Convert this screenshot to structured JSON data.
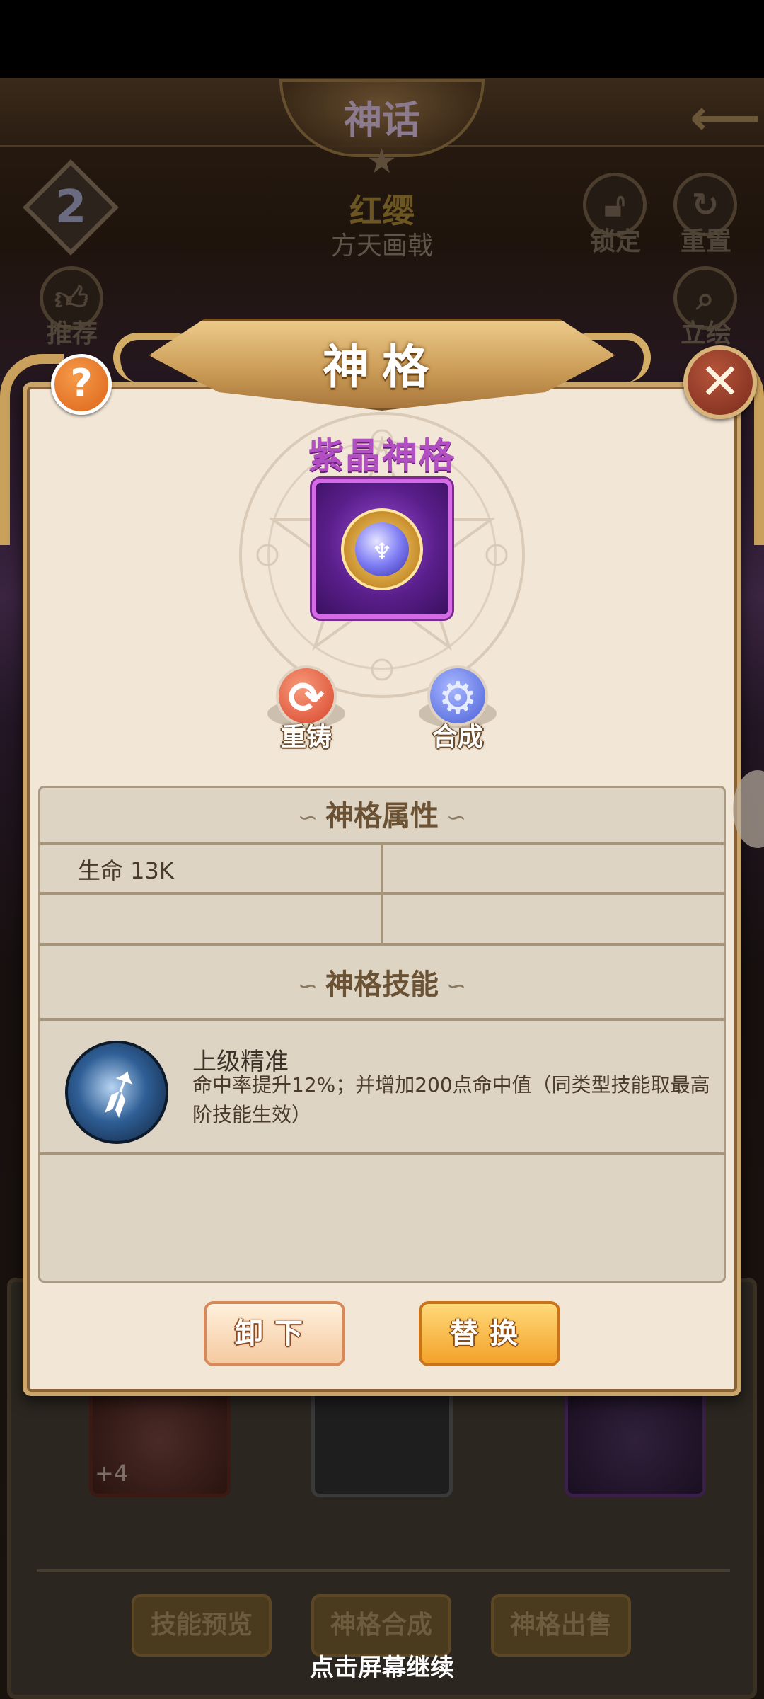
{
  "background": {
    "screen_title": "神话",
    "level": "2",
    "hero_name": "红缨",
    "hero_weapon": "方天画戟",
    "buttons": {
      "lock": "锁定",
      "reset": "重置",
      "recommend": "推荐",
      "portrait": "立绘"
    },
    "card_count": "+4",
    "bottom_buttons": [
      "技能预览",
      "神格合成",
      "神格出售"
    ],
    "continue_hint": "点击屏幕继续"
  },
  "modal": {
    "title": "神格",
    "help_label": "?",
    "close_label": "✕",
    "item": {
      "name": "紫晶神格",
      "rarity_color": "#b24fc2"
    },
    "actions": {
      "reforge": "重铸",
      "compose": "合成"
    },
    "attributes": {
      "header": "神格属性",
      "rows": [
        {
          "left": "生命   13K",
          "right": ""
        },
        {
          "left": "",
          "right": ""
        }
      ]
    },
    "skills": {
      "header": "神格技能",
      "items": [
        {
          "name": "上级精准",
          "description": "命中率提升12%；并增加200点命中值（同类型技能取最高阶技能生效）"
        }
      ]
    },
    "buttons": {
      "unequip": "卸下",
      "replace": "替换"
    }
  }
}
